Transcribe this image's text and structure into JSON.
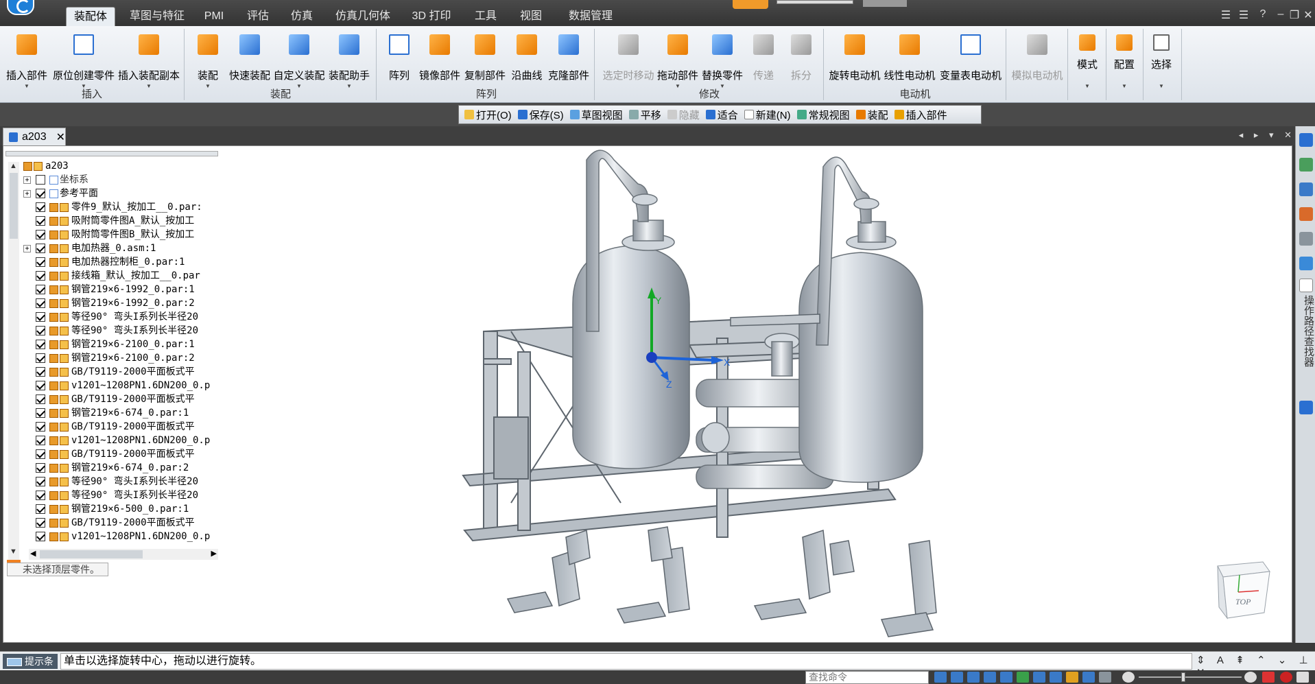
{
  "ribbon_tabs": [
    "装配体",
    "草图与特征",
    "PMI",
    "评估",
    "仿真",
    "仿真几何体",
    "3D 打印",
    "工具",
    "视图",
    "数据管理"
  ],
  "ribbon": {
    "insert_part": "插入部件",
    "create_in_place": "原位创建零件",
    "insert_copy": "插入装配副本",
    "group_insert": "插入",
    "assemble": "装配",
    "quick_assemble": "快速装配",
    "custom_assemble": "自定义装配",
    "assemble_assistant": "装配助手",
    "group_assemble": "装配",
    "array": "阵列",
    "mirror_part": "镜像部件",
    "copy_part": "复制部件",
    "along_curve": "沿曲线",
    "clone_part": "克隆部件",
    "group_array": "阵列",
    "move_when_selected": "选定时移动",
    "drag_part": "拖动部件",
    "replace_part": "替换零件",
    "transmit": "传递",
    "disassemble": "拆分",
    "group_modify": "修改",
    "rotary_motor": "旋转电动机",
    "linear_motor": "线性电动机",
    "variable_table_motor": "变量表电动机",
    "simulate_motor": "模拟电动机",
    "group_motor": "电动机",
    "mode": "模式",
    "config": "配置",
    "select": "选择"
  },
  "quickbar": [
    "打开(O)",
    "保存(S)",
    "草图视图",
    "平移",
    "隐藏",
    "适合",
    "新建(N)",
    "常规视图",
    "装配",
    "插入部件"
  ],
  "document": {
    "tab": "a203"
  },
  "tree": {
    "root": "a203",
    "items": [
      {
        "label": "坐标系",
        "expand": true,
        "checked": false,
        "kind": "coord"
      },
      {
        "label": "参考平面",
        "expand": true,
        "checked": true,
        "kind": "plane"
      },
      {
        "label": "零件9_默认_按加工__0.par:",
        "expand": false,
        "checked": true,
        "kind": "part"
      },
      {
        "label": "吸附筒零件图A_默认_按加工",
        "expand": false,
        "checked": true,
        "kind": "part"
      },
      {
        "label": "吸附筒零件图B_默认_按加工",
        "expand": false,
        "checked": true,
        "kind": "part"
      },
      {
        "label": "电加热器_0.asm:1",
        "expand": true,
        "checked": true,
        "kind": "asm"
      },
      {
        "label": "电加热器控制柜_0.par:1",
        "expand": false,
        "checked": true,
        "kind": "part"
      },
      {
        "label": "接线箱_默认_按加工__0.par",
        "expand": false,
        "checked": true,
        "kind": "part"
      },
      {
        "label": "钢管219×6-1992_0.par:1",
        "expand": false,
        "checked": true,
        "kind": "part"
      },
      {
        "label": "钢管219×6-1992_0.par:2",
        "expand": false,
        "checked": true,
        "kind": "part"
      },
      {
        "label": "等径90° 弯头I系列长半径20",
        "expand": false,
        "checked": true,
        "kind": "part"
      },
      {
        "label": "等径90° 弯头I系列长半径20",
        "expand": false,
        "checked": true,
        "kind": "part"
      },
      {
        "label": "钢管219×6-2100_0.par:1",
        "expand": false,
        "checked": true,
        "kind": "part"
      },
      {
        "label": "钢管219×6-2100_0.par:2",
        "expand": false,
        "checked": true,
        "kind": "part"
      },
      {
        "label": "GB/T9119-2000平面板式平",
        "expand": false,
        "checked": true,
        "kind": "part"
      },
      {
        "label": "v1201~1208PN1.6DN200_0.p",
        "expand": false,
        "checked": true,
        "kind": "part"
      },
      {
        "label": "GB/T9119-2000平面板式平",
        "expand": false,
        "checked": true,
        "kind": "part"
      },
      {
        "label": "钢管219×6-674_0.par:1",
        "expand": false,
        "checked": true,
        "kind": "part"
      },
      {
        "label": "GB/T9119-2000平面板式平",
        "expand": false,
        "checked": true,
        "kind": "part"
      },
      {
        "label": "v1201~1208PN1.6DN200_0.p",
        "expand": false,
        "checked": true,
        "kind": "part"
      },
      {
        "label": "GB/T9119-2000平面板式平",
        "expand": false,
        "checked": true,
        "kind": "part"
      },
      {
        "label": "钢管219×6-674_0.par:2",
        "expand": false,
        "checked": true,
        "kind": "part"
      },
      {
        "label": "等径90° 弯头I系列长半径20",
        "expand": false,
        "checked": true,
        "kind": "part"
      },
      {
        "label": "等径90° 弯头I系列长半径20",
        "expand": false,
        "checked": true,
        "kind": "part"
      },
      {
        "label": "钢管219×6-500_0.par:1",
        "expand": false,
        "checked": true,
        "kind": "part"
      },
      {
        "label": "GB/T9119-2000平面板式平",
        "expand": false,
        "checked": true,
        "kind": "part"
      },
      {
        "label": "v1201~1208PN1.6DN200_0.p",
        "expand": false,
        "checked": true,
        "kind": "part"
      }
    ],
    "status": "未选择顶层零件。"
  },
  "viewport": {
    "axis_x": "X",
    "axis_y": "Y",
    "axis_z": "Z",
    "viewcube_face": "TOP"
  },
  "right_panel_label": "操作路径查找器",
  "prompt": {
    "tag": "提示条",
    "text": "单击以选择旋转中心，拖动以进行旋转。"
  },
  "statusbar": {
    "search_placeholder": "查找命令"
  },
  "colors": {
    "accent": "#2a6fd1",
    "orange": "#e87a00",
    "model": "#bcc3cb"
  }
}
